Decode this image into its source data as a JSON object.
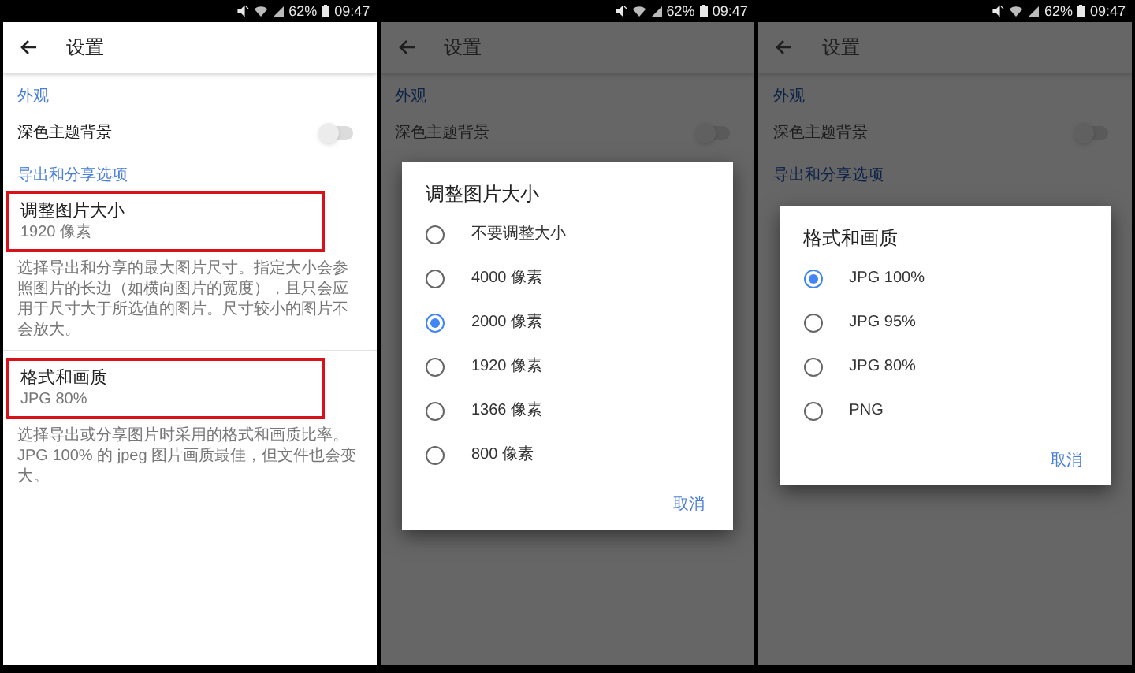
{
  "screens": [
    {
      "dimmed": false,
      "status_bar": {
        "battery": "62%",
        "time": "09:47"
      },
      "title": "设置",
      "sections": [
        {
          "header": "外观",
          "items": [
            {
              "kind": "toggle",
              "label": "深色主题背景",
              "on": false
            }
          ]
        },
        {
          "header": "导出和分享选项",
          "items": [
            {
              "kind": "choice",
              "label": "调整图片大小",
              "value": "1920 像素",
              "highlighted": true,
              "description": "选择导出和分享的最大图片尺寸。指定大小会参照图片的长边（如横向图片的宽度），且只会应用于尺寸大于所选值的图片。尺寸较小的图片不会放大。"
            },
            {
              "kind": "choice",
              "label": "格式和画质",
              "value": "JPG 80%",
              "highlighted": true,
              "description": "选择导出或分享图片时采用的格式和画质比率。JPG 100% 的 jpeg 图片画质最佳，但文件也会变大。"
            }
          ]
        }
      ]
    },
    {
      "dimmed": true,
      "status_bar": {
        "battery": "62%",
        "time": "09:47"
      },
      "title": "设置",
      "sections": [
        {
          "header": "外观",
          "items": [
            {
              "kind": "toggle",
              "label": "深色主题背景",
              "on": false
            }
          ]
        }
      ],
      "dialog": {
        "title": "调整图片大小",
        "options": [
          {
            "label": "不要调整大小",
            "selected": false
          },
          {
            "label": "4000 像素",
            "selected": false
          },
          {
            "label": "2000 像素",
            "selected": true
          },
          {
            "label": "1920 像素",
            "selected": false
          },
          {
            "label": "1366 像素",
            "selected": false
          },
          {
            "label": "800 像素",
            "selected": false
          }
        ],
        "cancel": "取消"
      }
    },
    {
      "dimmed": true,
      "status_bar": {
        "battery": "62%",
        "time": "09:47"
      },
      "title": "设置",
      "sections": [
        {
          "header": "外观",
          "items": [
            {
              "kind": "toggle",
              "label": "深色主题背景",
              "on": false
            }
          ]
        },
        {
          "header": "导出和分享选项"
        }
      ],
      "dialog": {
        "title": "格式和画质",
        "options": [
          {
            "label": "JPG 100%",
            "selected": true
          },
          {
            "label": "JPG 95%",
            "selected": false
          },
          {
            "label": "JPG 80%",
            "selected": false
          },
          {
            "label": "PNG",
            "selected": false
          }
        ],
        "cancel": "取消"
      }
    }
  ]
}
